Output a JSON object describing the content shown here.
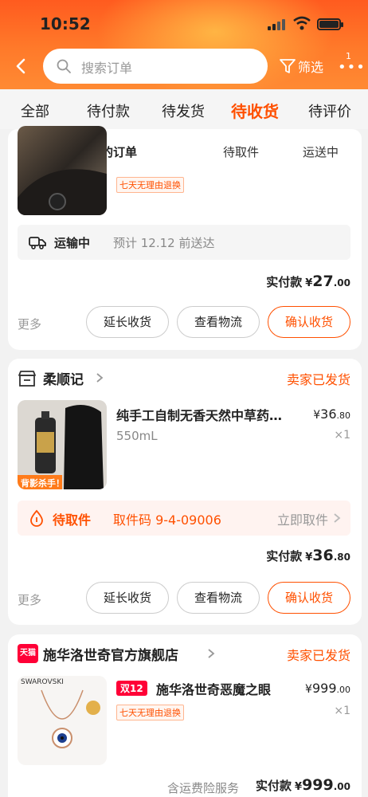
{
  "status_bar": {
    "time": "10:52"
  },
  "header": {
    "search_placeholder": "搜索订单",
    "filter_label": "筛选",
    "more_count": "1",
    "more_dots": "•••"
  },
  "tabs": [
    {
      "label": "全部",
      "active": false
    },
    {
      "label": "待付款",
      "active": false
    },
    {
      "label": "待发货",
      "active": false
    },
    {
      "label": "待收货",
      "active": true
    },
    {
      "label": "待评价",
      "active": false
    }
  ],
  "subfilter": {
    "title": "你可筛选未签收的订单",
    "options": [
      "待取件",
      "运送中"
    ]
  },
  "orders": [
    {
      "return_badge": "七天无理由退换",
      "shipping": {
        "status": "运输中",
        "eta": "预计 12.12 前送达"
      },
      "paid": {
        "label": "实付款",
        "currency": "¥",
        "int": "27",
        "dec": ".00"
      },
      "actions": {
        "more": "更多",
        "extend": "延长收货",
        "logistics": "查看物流",
        "confirm": "确认收货"
      }
    },
    {
      "shop": "柔顺记",
      "status": "卖家已发货",
      "product": {
        "title": "纯手工自制无香天然中草药…",
        "spec": "550mL",
        "price_currency": "¥",
        "price_int": "36",
        "price_dec": ".80",
        "qty": "×1",
        "thumb_label": "背影杀手！"
      },
      "pickup": {
        "status": "待取件",
        "code": "取件码 9-4-09006",
        "action": "立即取件"
      },
      "paid": {
        "label": "实付款",
        "currency": "¥",
        "int": "36",
        "dec": ".80"
      },
      "actions": {
        "more": "更多",
        "extend": "延长收货",
        "logistics": "查看物流",
        "confirm": "确认收货"
      }
    },
    {
      "shop": "施华洛世奇官方旗舰店",
      "shop_badge": "天猫",
      "status": "卖家已发货",
      "product": {
        "promo": "双12",
        "title": "施华洛世奇恶魔之眼",
        "return_badge": "七天无理由退换",
        "price_currency": "¥",
        "price_int": "999",
        "price_dec": ".00",
        "qty": "×1",
        "thumb_brand": "SWAROVSKI"
      },
      "insurance": "含运费险服务",
      "paid": {
        "label": "实付款",
        "currency": "¥",
        "int": "999",
        "dec": ".00"
      }
    }
  ],
  "colors": {
    "accent": "#ff5000",
    "header_gradient_top": "#ff5b1f",
    "tmall_red": "#ff0036"
  },
  "icons": [
    "back-arrow-icon",
    "search-icon",
    "filter-icon",
    "more-icon",
    "truck-icon",
    "shop-icon",
    "chevron-right-icon",
    "pickup-drop-icon",
    "tmall-icon"
  ]
}
